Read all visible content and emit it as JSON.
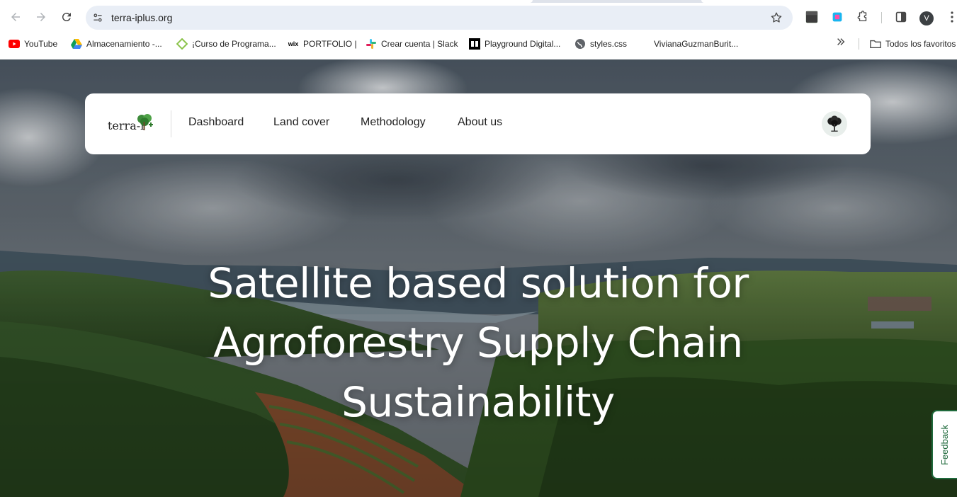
{
  "browser": {
    "url": "terra-iplus.org",
    "avatar_letter": "V",
    "bookmarks": [
      {
        "label": "YouTube",
        "icon": "youtube-icon"
      },
      {
        "label": "Almacenamiento -...",
        "icon": "google-drive-icon"
      },
      {
        "label": "¡Curso de Programa...",
        "icon": "course-icon"
      },
      {
        "label": "PORTFOLIO |",
        "icon": "wix-icon"
      },
      {
        "label": "Crear cuenta | Slack",
        "icon": "slack-icon"
      },
      {
        "label": "Playground Digital...",
        "icon": "playground-icon"
      },
      {
        "label": "styles.css",
        "icon": "globe-icon"
      },
      {
        "label": "VivianaGuzmanBurit...",
        "icon": "blank-icon"
      }
    ],
    "all_bookmarks_label": "Todos los favoritos"
  },
  "site": {
    "logo_text": "terra-i",
    "nav": [
      {
        "label": "Dashboard"
      },
      {
        "label": "Land cover"
      },
      {
        "label": "Methodology"
      },
      {
        "label": "About us"
      }
    ],
    "headline_lines": [
      "Satellite based solution for",
      "Agroforestry Supply Chain",
      "Sustainability"
    ],
    "feedback_label": "Feedback"
  },
  "colors": {
    "brand_green": "#1f6a3c",
    "omnibox_bg": "#e9eef6"
  }
}
